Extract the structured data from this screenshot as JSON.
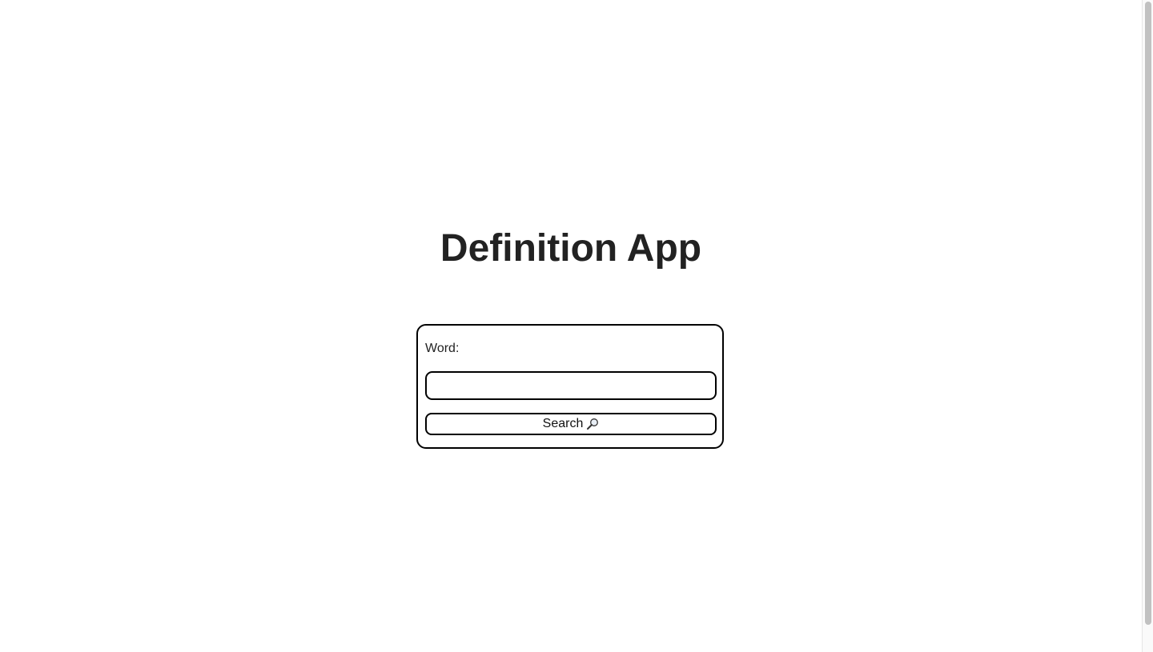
{
  "app": {
    "title": "Definition App"
  },
  "form": {
    "word_label": "Word:",
    "word_value": "",
    "word_placeholder": "",
    "search_label": "Search",
    "search_icon": "magnifier-icon"
  },
  "colors": {
    "text": "#222222",
    "border": "#000000",
    "background": "#ffffff",
    "scrollbar_thumb": "#c1c1c1"
  },
  "scroll": {
    "position": 0
  }
}
